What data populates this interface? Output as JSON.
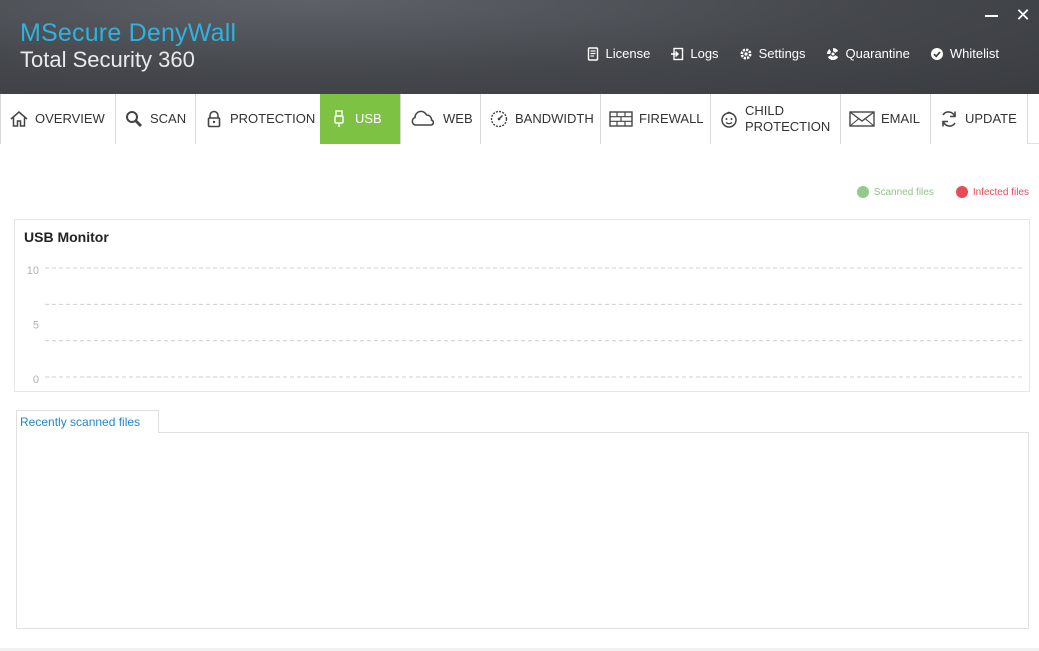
{
  "header": {
    "brand_line1": "MSecure DenyWall",
    "brand_line2": "Total Security 360",
    "close_glyph": "✕",
    "menu": [
      {
        "label": "License",
        "icon": "license-icon"
      },
      {
        "label": "Logs",
        "icon": "logs-icon"
      },
      {
        "label": "Settings",
        "icon": "gear-icon"
      },
      {
        "label": "Quarantine",
        "icon": "quarantine-icon"
      },
      {
        "label": "Whitelist",
        "icon": "check-circle-icon"
      }
    ]
  },
  "tabs": [
    {
      "label": "OVERVIEW",
      "icon": "home-icon"
    },
    {
      "label": "SCAN",
      "icon": "magnifier-icon"
    },
    {
      "label": "PROTECTION",
      "icon": "lock-icon"
    },
    {
      "label": "USB",
      "icon": "usb-icon",
      "active": true
    },
    {
      "label": "WEB",
      "icon": "cloud-icon"
    },
    {
      "label": "BANDWIDTH",
      "icon": "speedometer-icon"
    },
    {
      "label": "FIREWALL",
      "icon": "brick-wall-icon"
    },
    {
      "label": "CHILD",
      "label2": "PROTECTION",
      "icon": "child-face-icon"
    },
    {
      "label": "EMAIL",
      "icon": "envelope-icon"
    },
    {
      "label": "UPDATE",
      "icon": "refresh-icon"
    }
  ],
  "legend": [
    {
      "label": "Scanned files",
      "color": "#93c98a"
    },
    {
      "label": "Infected files",
      "color": "#e84b57"
    }
  ],
  "colors": {
    "accent": "#7dc242",
    "brand": "#2fb2e0",
    "link": "#1e88c9"
  },
  "chart_data": {
    "type": "line",
    "title": "USB Monitor",
    "y_ticks": [
      "10",
      "5",
      "0"
    ],
    "ylim": [
      0,
      10
    ],
    "grid": true,
    "series": []
  },
  "recent": {
    "tab_label": "Recently scanned files",
    "files": []
  }
}
